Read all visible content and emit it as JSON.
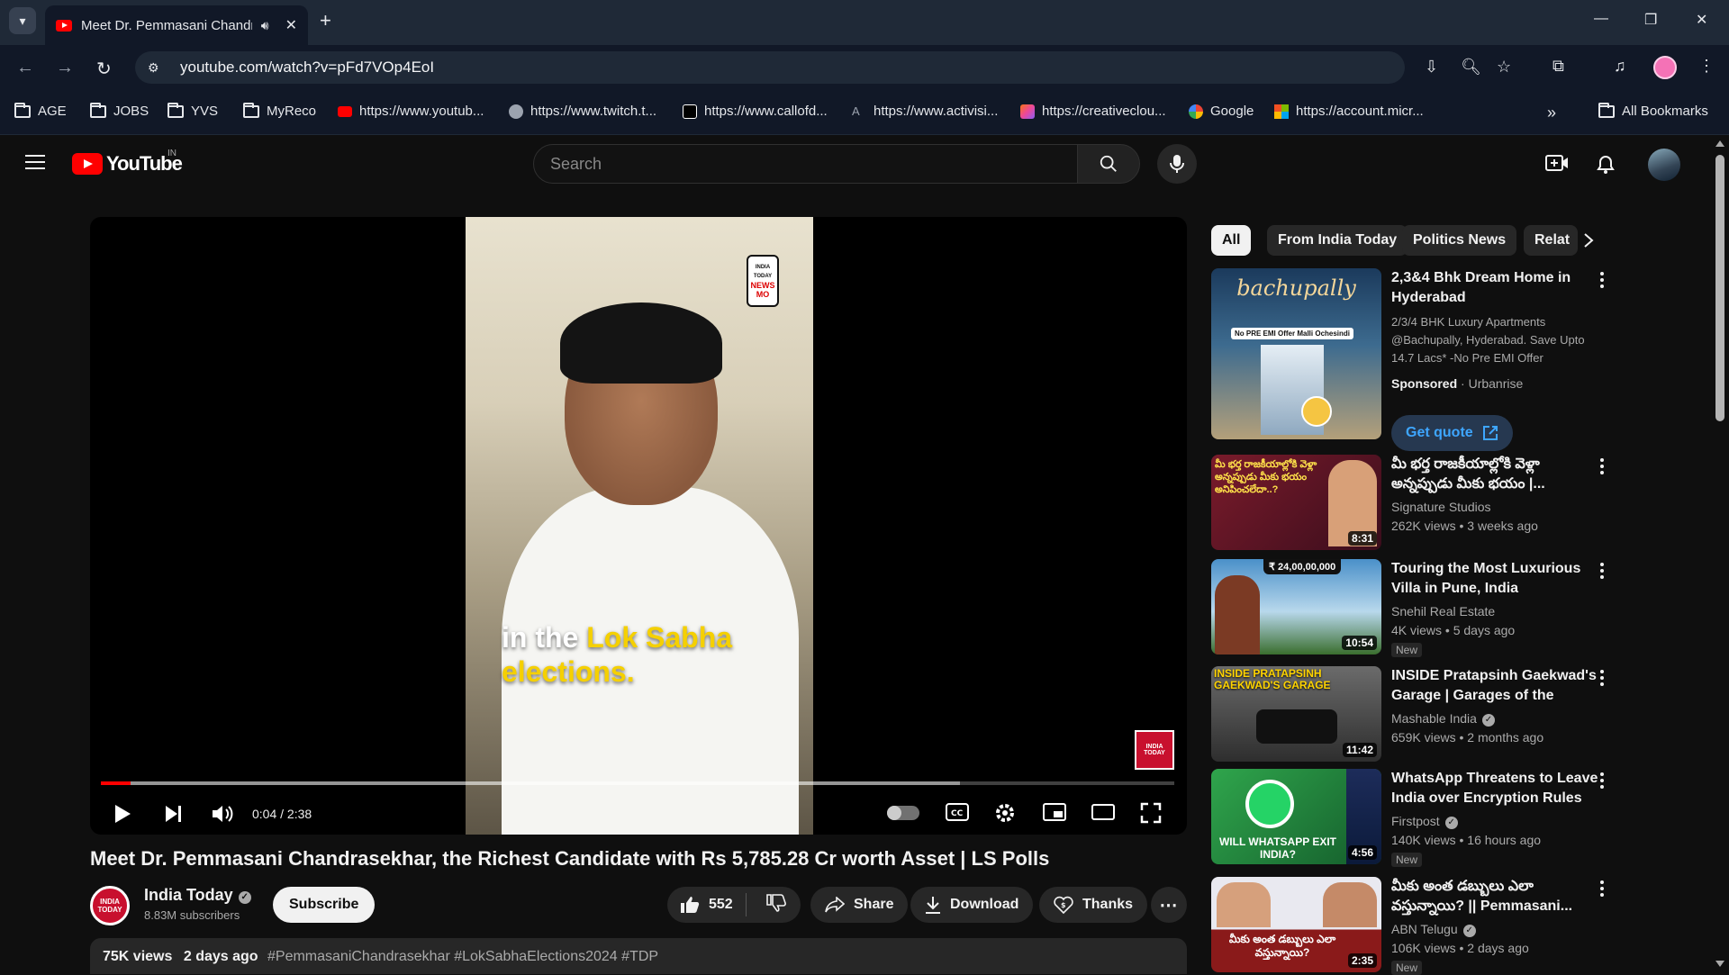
{
  "browser": {
    "tab_title": "Meet Dr. Pemmasani Chandrasekhar",
    "url": "youtube.com/watch?v=pFd7VOp4EoI",
    "bookmarks": [
      {
        "label": "AGE",
        "icon": "folder-icon"
      },
      {
        "label": "JOBS",
        "icon": "folder-icon"
      },
      {
        "label": "YVS",
        "icon": "folder-icon"
      },
      {
        "label": "MyReco",
        "icon": "folder-icon"
      },
      {
        "label": "https://www.youtub...",
        "icon": "youtube-icon"
      },
      {
        "label": "https://www.twitch.t...",
        "icon": "globe-icon"
      },
      {
        "label": "https://www.callofd...",
        "icon": "callofduty-icon"
      },
      {
        "label": "https://www.activisi...",
        "icon": "activision-icon"
      },
      {
        "label": "https://creativeclou...",
        "icon": "creativecloud-icon"
      },
      {
        "label": "Google",
        "icon": "google-icon"
      },
      {
        "label": "https://account.micr...",
        "icon": "microsoft-icon"
      }
    ],
    "all_bookmarks": "All Bookmarks",
    "colors": {
      "chrome_bg": "#1f2937",
      "toolbar_bg": "#111827"
    }
  },
  "youtube": {
    "logo_text": "YouTube",
    "country": "IN",
    "search_placeholder": "Search",
    "player": {
      "caption_pre": "in the ",
      "caption_hl": "Lok Sabha",
      "caption_post": "elections.",
      "newsmo": [
        "INDIA",
        "TODAY",
        "NEWS",
        "MO"
      ],
      "badge": "INDIA TODAY",
      "timecode": "0:04 / 2:38",
      "progress_played": 0.028,
      "progress_buffered": 0.8
    },
    "video": {
      "title": "Meet Dr. Pemmasani Chandrasekhar, the Richest Candidate with Rs 5,785.28 Cr worth Asset | LS Polls",
      "channel": "India Today",
      "subscribers": "8.83M subscribers",
      "channel_avatar_text": "INDIA TODAY",
      "subscribe": "Subscribe",
      "likes": "552",
      "share": "Share",
      "download": "Download",
      "thanks": "Thanks",
      "views": "75K views",
      "age": "2 days ago",
      "hashtags": "#PemmasaniChandrasekhar #LokSabhaElections2024 #TDP"
    },
    "chips": [
      "All",
      "From India Today",
      "Politics News",
      "Relat"
    ],
    "ad": {
      "title": "2,3&4 Bhk Dream Home in Hyderabad",
      "description": "2/3/4 BHK Luxury Apartments @Bachupally, Hyderabad. Save Upto 14.7 Lacs* -No Pre EMI Offer",
      "sponsored": "Sponsored",
      "advertiser": "Urbanrise",
      "cta": "Get quote",
      "thumb_text": "bachupally",
      "thumb_sub": "No PRE EMI Offer Malli Ochesindi"
    },
    "recommendations": [
      {
        "title": "మీ భర్త రాజకీయాల్లోకి వెళ్లా అన్నప్పుడు మీకు భయం |...",
        "channel": "Signature Studios",
        "verified": false,
        "views": "262K views",
        "age": "3 weeks ago",
        "duration": "8:31",
        "new": false,
        "thumb_text": "మీ భర్త రాజకీయాల్లోకి వెళ్లా అన్నప్పుడు మీకు భయం అనిపించలేదా..?",
        "thumb_bg": "#7a1b2b"
      },
      {
        "title": "Touring the Most Luxurious Villa in Pune, India",
        "channel": "Snehil Real Estate",
        "verified": false,
        "views": "4K views",
        "age": "5 days ago",
        "duration": "10:54",
        "new": true,
        "thumb_text": "₹ 24,00,00,000",
        "thumb_bg": "#1e5d8a"
      },
      {
        "title": "INSIDE Pratapsinh Gaekwad's Garage | Garages of the Rich...",
        "channel": "Mashable India",
        "verified": true,
        "views": "659K views",
        "age": "2 months ago",
        "duration": "11:42",
        "new": false,
        "thumb_text": "INSIDE PRATAPSINH GAEKWAD'S GARAGE",
        "thumb_bg": "#5b5b5b"
      },
      {
        "title": "WhatsApp Threatens to Leave India over Encryption Rules |...",
        "channel": "Firstpost",
        "verified": true,
        "views": "140K views",
        "age": "16 hours ago",
        "duration": "4:56",
        "new": true,
        "thumb_text": "WILL WHATSAPP EXIT INDIA?",
        "thumb_bg": "#1f7a3f"
      },
      {
        "title": "మీకు అంత డబ్బులు ఎలా వస్తున్నాయి? || Pemmasani...",
        "channel": "ABN Telugu",
        "verified": true,
        "views": "106K views",
        "age": "2 days ago",
        "duration": "2:35",
        "new": true,
        "thumb_text": "మీకు అంత డబ్బులు ఎలా వస్తున్నాయి?",
        "thumb_bg": "#8a1a1a"
      }
    ]
  }
}
